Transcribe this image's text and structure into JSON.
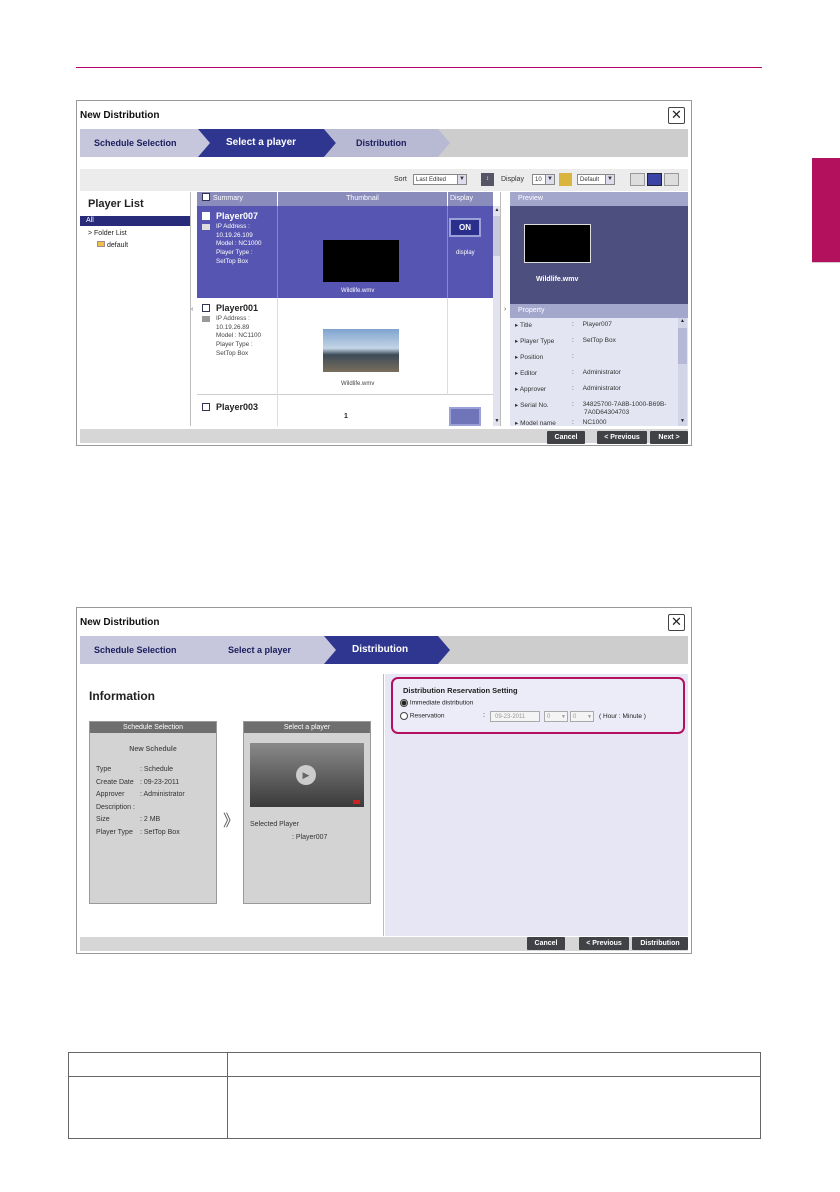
{
  "window1": {
    "title": "New Distribution",
    "steps": [
      "Schedule Selection",
      "Select a player",
      "Distribution"
    ],
    "toolbar": {
      "sort_label": "Sort",
      "sort_value": "Last Edited",
      "display_label": "Display",
      "display_value": "10",
      "view_value": "Default"
    },
    "player_list": {
      "title": "Player List",
      "all": "All",
      "folder_list": "> Folder List",
      "folder": "default"
    },
    "columns": [
      "Summary",
      "Thumbnail",
      "Display"
    ],
    "players": [
      {
        "name": "Player007",
        "info": [
          "IP Address :",
          "10.19.26.109",
          "Model : NC1000",
          "Player Type :",
          "SetTop Box"
        ],
        "thumb_caption": "Wildlife.wmv",
        "display_btn": "ON",
        "display_text": "display"
      },
      {
        "name": "Player001",
        "info": [
          "IP Address :",
          "10.19.26.89",
          "Model : NC1100",
          "Player Type :",
          "SetTop Box"
        ],
        "thumb_caption": "Wildlife.wmv"
      },
      {
        "name": "Player003",
        "page_number": "1"
      }
    ],
    "preview": {
      "title": "Preview",
      "caption": "Wildlife.wmv"
    },
    "property": {
      "title": "Property",
      "rows": [
        {
          "key": "Title",
          "value": "Player007"
        },
        {
          "key": "Player Type",
          "value": "SetTop Box"
        },
        {
          "key": "Position",
          "value": ""
        },
        {
          "key": "Editor",
          "value": "Administrator"
        },
        {
          "key": "Approver",
          "value": "Administrator"
        },
        {
          "key": "Serial No.",
          "value": "34825700-7A8B-1000-B69B-",
          "value2": "7A0D64304703"
        },
        {
          "key": "Model name",
          "value": "NC1000"
        }
      ]
    },
    "buttons": {
      "cancel": "Cancel",
      "previous": "< Previous",
      "next": "Next >"
    }
  },
  "window2": {
    "title": "New Distribution",
    "steps": [
      "Schedule Selection",
      "Select a player",
      "Distribution"
    ],
    "info_title": "Information",
    "schedule_box": {
      "header": "Schedule Selection",
      "name": "New Schedule",
      "rows": [
        {
          "key": "Type",
          "value": ": Schedule"
        },
        {
          "key": "Create Date",
          "value": ": 09-23-2011"
        },
        {
          "key": "Approver",
          "value": ": Administrator"
        },
        {
          "key": "Description :",
          "value": ""
        },
        {
          "key": "Size",
          "value": ": 2 MB"
        },
        {
          "key": "Player Type",
          "value": ": SetTop Box"
        }
      ]
    },
    "arrow": "》",
    "player_box": {
      "header": "Select a player",
      "selected_label": "Selected Player",
      "selected_value": ": Player007"
    },
    "reservation": {
      "title": "Distribution Reservation Setting",
      "immediate": "Immediate distribution",
      "reservation": "Reservation",
      "colon": ":",
      "date": "09-23-2011",
      "hour": "0",
      "minute": "0",
      "unit": "( Hour : Minute )"
    },
    "buttons": {
      "cancel": "Cancel",
      "previous": "< Previous",
      "distribution": "Distribution"
    }
  }
}
